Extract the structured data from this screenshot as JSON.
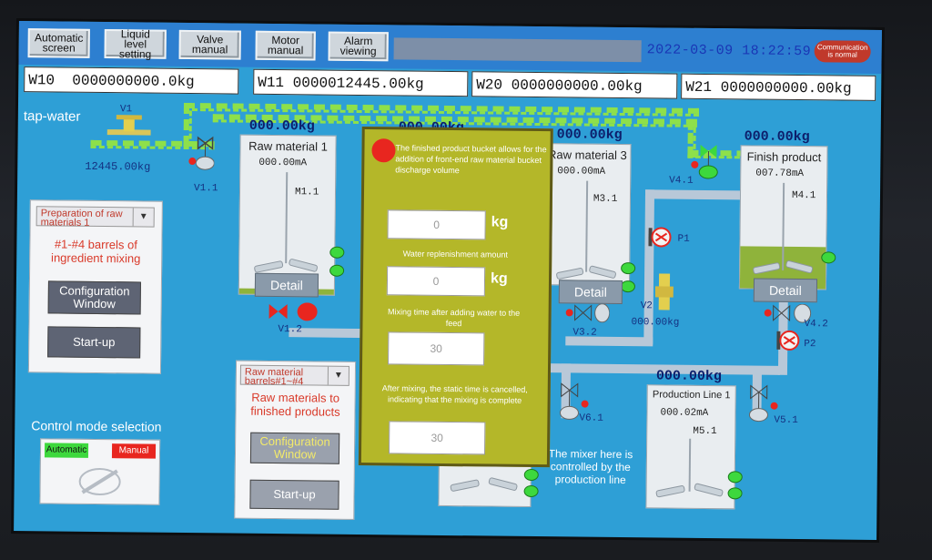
{
  "nav": {
    "automatic_screen": "Automatic screen",
    "liquid_level_setting": "Liquid level setting",
    "valve_manual": "Valve manual",
    "motor_manual": "Motor manual",
    "alarm_viewing": "Alarm viewing"
  },
  "header": {
    "datetime": "2022-03-09 18:22:59",
    "comm_status": "Communication is normal"
  },
  "weighers": [
    {
      "label": "W10",
      "value": "0000000000.0kg"
    },
    {
      "label": "W11",
      "value": "0000012445.00kg"
    },
    {
      "label": "W20",
      "value": "0000000000.00kg"
    },
    {
      "label": "W21",
      "value": "0000000000.00kg"
    }
  ],
  "tap_water": {
    "label": "tap-water",
    "valve": "V1",
    "weight": "12445.00kg"
  },
  "tanks": {
    "raw1": {
      "weight": "000.00kg",
      "name": "Raw material 1",
      "current": "000.00mA",
      "motor": "M1.1",
      "detail": "Detail"
    },
    "raw2": {
      "weight": "000.00kg"
    },
    "raw3": {
      "weight": "000.00kg",
      "name": "Raw material 3",
      "current": "000.00mA",
      "motor": "M3.1",
      "detail": "Detail"
    },
    "finish": {
      "weight": "000.00kg",
      "name": "Finish product",
      "current": "007.78mA",
      "motor": "M4.1",
      "detail": "Detail"
    },
    "line1": {
      "weight": "000.00kg",
      "name": "Production Line 1",
      "current": "000.02mA",
      "motor": "M5.1"
    }
  },
  "valves": {
    "v1_1": "V1.1",
    "v1_2": "V1.2",
    "v3_2": "V3.2",
    "v4_1": "V4.1",
    "v4_2": "V4.2",
    "v6_1": "V6.1",
    "v5_1": "V5.1",
    "v2": "V2",
    "v2_weight": "000.00kg",
    "p1": "P1",
    "p2": "P2"
  },
  "prep_panel": {
    "select": "Preparation of raw materials 1",
    "desc": "#1-#4 barrels of ingredient mixing",
    "config": "Configuration Window",
    "start": "Start-up"
  },
  "raw_panel": {
    "select": "Raw material barrels#1~#4",
    "desc": "Raw materials to finished products",
    "config": "Configuration Window",
    "start": "Start-up"
  },
  "control_mode": {
    "title": "Control mode selection",
    "automatic": "Automatic",
    "manual": "Manual"
  },
  "popup": {
    "line1": "The finished product bucket allows for the addition of front-end raw material bucket discharge volume",
    "field1": "0",
    "unit1": "kg",
    "line2": "Water replenishment amount",
    "field2": "0",
    "unit2": "kg",
    "line3": "Mixing time after adding water to the feed",
    "field3": "30",
    "line4": "After mixing, the static time is cancelled, indicating that the mixing is complete",
    "field4": "30"
  },
  "footnote": "The mixer here is controlled by the production line",
  "colors": {
    "screen_bg": "#2e9fd6",
    "pipe_water": "#8ee04a",
    "alarm_red": "#e8261f",
    "lamp_green": "#3dd83d",
    "popup_bg": "#b4b729"
  }
}
